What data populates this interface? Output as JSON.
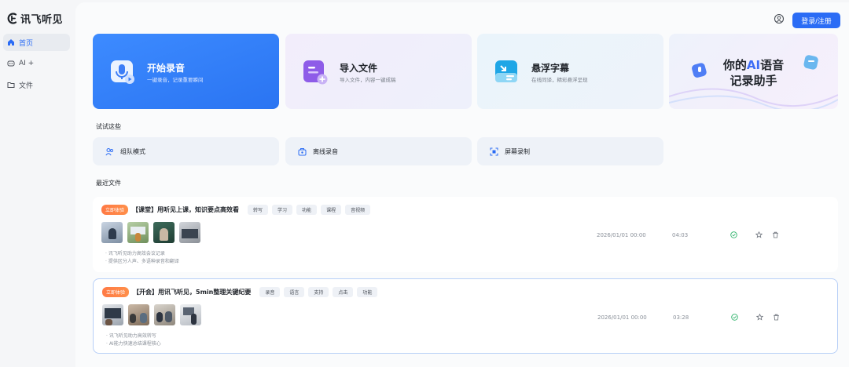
{
  "app": {
    "name": "讯飞听见"
  },
  "sidebar": {
    "items": [
      {
        "label": "首页",
        "icon": "home-icon",
        "active": true
      },
      {
        "label": "AI +",
        "icon": "ai-icon",
        "active": false
      },
      {
        "label": "文件",
        "icon": "folder-icon",
        "active": false
      }
    ]
  },
  "header": {
    "login_label": "登录/注册",
    "avatar_icon": "user-switch-icon"
  },
  "features": [
    {
      "title": "开始录音",
      "subtitle": "一键录音，记录重要瞬间",
      "icon": "mic-icon"
    },
    {
      "title": "导入文件",
      "subtitle": "导入文件，内容一键成稿",
      "icon": "import-file-icon"
    },
    {
      "title": "悬浮字幕",
      "subtitle": "在线同译，精彩悬浮呈现",
      "icon": "caption-icon"
    }
  ],
  "promo": {
    "line1_pre": "你的",
    "line1_ai": "AI",
    "line1_post": "语音",
    "line2": "记录助手"
  },
  "try_section": {
    "title": "试试这些",
    "items": [
      {
        "label": "组队模式",
        "icon": "team-icon"
      },
      {
        "label": "离线录音",
        "icon": "offline-record-icon"
      },
      {
        "label": "屏幕录制",
        "icon": "screen-record-icon"
      }
    ]
  },
  "recent": {
    "title": "最近文件",
    "files": [
      {
        "badge": "立即体验",
        "title": "【课堂】用听见上课，知识要点高效看",
        "tags": [
          "转写",
          "学习",
          "功能",
          "课程",
          "音视频"
        ],
        "notes": [
          "讯飞听见助力高效会议记录",
          "提供区分人声、多语种录音和翻译"
        ],
        "date": "2026/01/01 00:00",
        "duration": "04:03"
      },
      {
        "badge": "立即体验",
        "title": "【开会】用讯飞听见，5min整理关键纪要",
        "tags": [
          "录音",
          "语言",
          "支持",
          "点击",
          "功能"
        ],
        "notes": [
          "讯飞听见助力高效转写",
          "AI能力快速总结课程核心"
        ],
        "date": "2026/01/01 00:00",
        "duration": "03:28"
      }
    ]
  },
  "colors": {
    "accent": "#2b6cf5",
    "badge": "#ff7a45",
    "done": "#2fb36b"
  }
}
